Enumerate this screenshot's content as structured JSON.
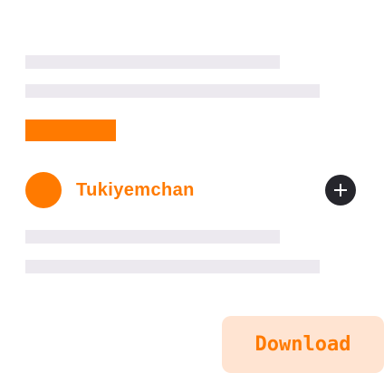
{
  "colors": {
    "accent": "#ff7a00",
    "placeholder": "#ece9ef",
    "download_bg": "#ffe4d2",
    "add_button_bg": "#26262c"
  },
  "user": {
    "name": "Tukiyemchan"
  },
  "actions": {
    "add_icon": "plus-icon",
    "download_label": "Download"
  }
}
